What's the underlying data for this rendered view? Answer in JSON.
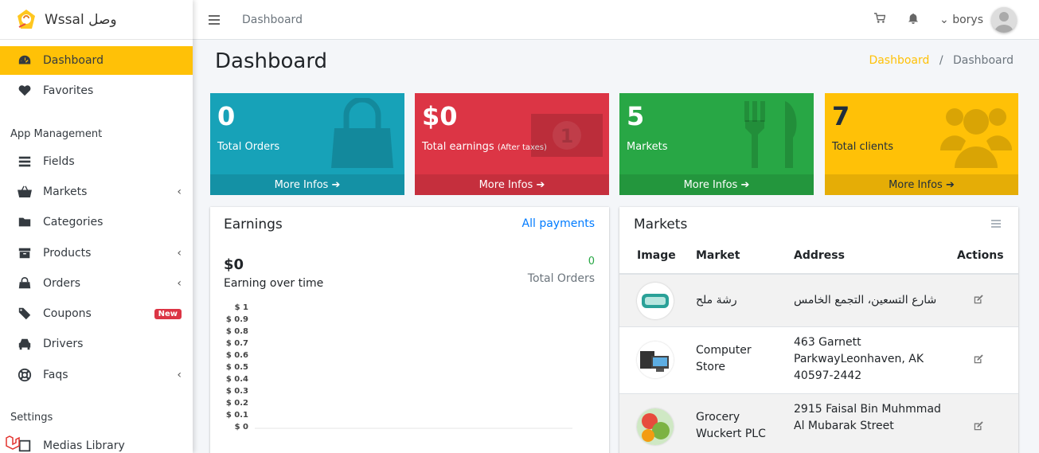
{
  "brand": {
    "name": "Wssal وصل"
  },
  "sidebar": {
    "items": [
      {
        "label": "Dashboard",
        "icon": "dashboard-icon",
        "active": true
      },
      {
        "label": "Favorites",
        "icon": "heart-icon"
      }
    ],
    "section_app": "App Management",
    "app_items": [
      {
        "label": "Fields",
        "icon": "fields-icon"
      },
      {
        "label": "Markets",
        "icon": "basket-icon",
        "chevron": "‹"
      },
      {
        "label": "Categories",
        "icon": "folder-icon"
      },
      {
        "label": "Products",
        "icon": "archive-icon",
        "chevron": "‹"
      },
      {
        "label": "Orders",
        "icon": "shopping-bag-icon",
        "chevron": "‹"
      },
      {
        "label": "Coupons",
        "icon": "ticket-icon",
        "badge": "New"
      },
      {
        "label": "Drivers",
        "icon": "car-icon"
      },
      {
        "label": "Faqs",
        "icon": "life-ring-icon",
        "chevron": "‹"
      }
    ],
    "section_settings": "Settings",
    "settings_items": [
      {
        "label": "Medias Library",
        "icon": "media-icon"
      }
    ]
  },
  "topbar": {
    "title": "Dashboard",
    "user": "borys",
    "user_chevron": "⌄"
  },
  "page": {
    "title": "Dashboard"
  },
  "breadcrumb": {
    "link": "Dashboard",
    "separator": "/",
    "current": "Dashboard"
  },
  "cards": [
    {
      "value": "0",
      "label": "Total Orders",
      "small": "",
      "footer": "More Infos",
      "color": "#17a2b8",
      "icon": "shopping-bag-icon"
    },
    {
      "value": "$0",
      "label": "Total earnings",
      "small": "(After taxes)",
      "footer": "More Infos",
      "color": "#dc3545",
      "icon": "money-icon"
    },
    {
      "value": "5",
      "label": "Markets",
      "small": "",
      "footer": "More Infos",
      "color": "#28a745",
      "icon": "cutlery-icon"
    },
    {
      "value": "7",
      "label": "Total clients",
      "small": "",
      "footer": "More Infos",
      "color": "#ffc107",
      "icon": "users-icon"
    }
  ],
  "earnings": {
    "title": "Earnings",
    "all_payments": "All payments",
    "amount": "$0",
    "subtitle": "Earning over time",
    "orders_count": "0",
    "orders_label": "Total Orders"
  },
  "chart_data": {
    "type": "line",
    "ylim": [
      0,
      1
    ],
    "y_ticks": [
      "$ 1",
      "$ 0.9",
      "$ 0.8",
      "$ 0.7",
      "$ 0.6",
      "$ 0.5",
      "$ 0.4",
      "$ 0.3",
      "$ 0.2",
      "$ 0.1",
      "$ 0"
    ],
    "series": []
  },
  "markets": {
    "title": "Markets",
    "headers": {
      "image": "Image",
      "market": "Market",
      "address": "Address",
      "actions": "Actions"
    },
    "rows": [
      {
        "name": "رشة ملح",
        "address": "شارع التسعين، التجمع الخامس"
      },
      {
        "name": "Computer Store",
        "address": "463 Garnett ParkwayLeonhaven, AK 40597-2442"
      },
      {
        "name": "Grocery Wuckert PLC",
        "address": "2915 Faisal Bin Muhmmad Al Mubarak Street"
      }
    ]
  }
}
